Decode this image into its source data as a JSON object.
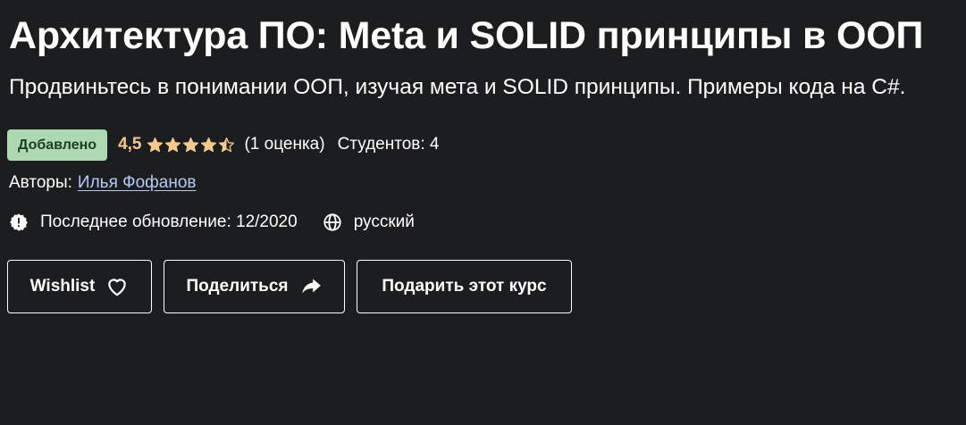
{
  "course": {
    "title": "Архитектура ПО: Meta и SOLID принципы в ООП",
    "subtitle": "Продвиньтесь в понимании ООП, изучая мета и SOLID принципы. Примеры кода на C#."
  },
  "rating": {
    "badge": "Добавлено",
    "value": "4,5",
    "stars": 4.5,
    "count": "(1 оценка)",
    "students": "Студентов: 4"
  },
  "authors": {
    "label": "Авторы:",
    "name": "Илья Фофанов"
  },
  "meta": {
    "updated": "Последнее обновление: 12/2020",
    "language": "русский",
    "update_icon": "alert-badge-icon",
    "language_icon": "globe-icon"
  },
  "actions": {
    "wishlist_label": "Wishlist",
    "share_label": "Поделиться",
    "gift_label": "Подарить этот курс"
  },
  "colors": {
    "background": "#1c1d1f",
    "badge_bg": "#acd9b2",
    "badge_text": "#1d3d24",
    "rating": "#f3ca8c",
    "link": "#b4c9f5"
  }
}
